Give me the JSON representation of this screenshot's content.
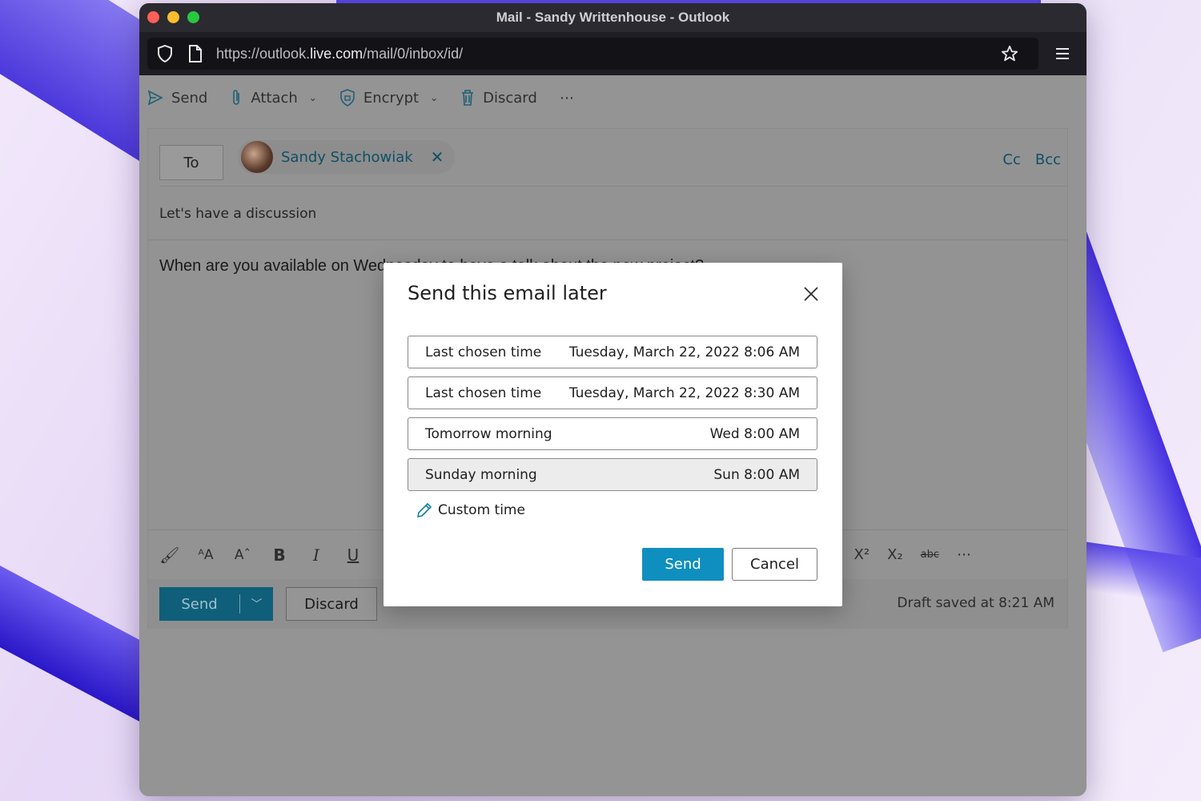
{
  "window": {
    "title": "Mail - Sandy Writtenhouse - Outlook"
  },
  "browser": {
    "url_prefix": "https://outlook.",
    "url_host": "live.com",
    "url_path": "/mail/0/inbox/id/"
  },
  "toolbar": {
    "send_label": "Send",
    "attach_label": "Attach",
    "encrypt_label": "Encrypt",
    "discard_label": "Discard",
    "more_label": "⋯"
  },
  "compose": {
    "to_label": "To",
    "recipient_name": "Sandy Stachowiak",
    "cc_label": "Cc",
    "bcc_label": "Bcc",
    "subject": "Let's have a discussion",
    "body": "When are you available on Wednesday to have a talk about the new project?",
    "send_label": "Send",
    "discard_label": "Discard",
    "draft_status": "Draft saved at 8:21 AM"
  },
  "dialog": {
    "title": "Send this email later",
    "options": [
      {
        "name": "Last chosen time",
        "time": "Tuesday, March 22, 2022 8:06 AM"
      },
      {
        "name": "Last chosen time",
        "time": "Tuesday, March 22, 2022 8:30 AM"
      },
      {
        "name": "Tomorrow morning",
        "time": "Wed 8:00 AM"
      },
      {
        "name": "Sunday morning",
        "time": "Sun 8:00 AM"
      }
    ],
    "custom_label": "Custom time",
    "send_label": "Send",
    "cancel_label": "Cancel"
  },
  "colors": {
    "accent": "#0f8fbf",
    "link": "#0f4f66"
  }
}
